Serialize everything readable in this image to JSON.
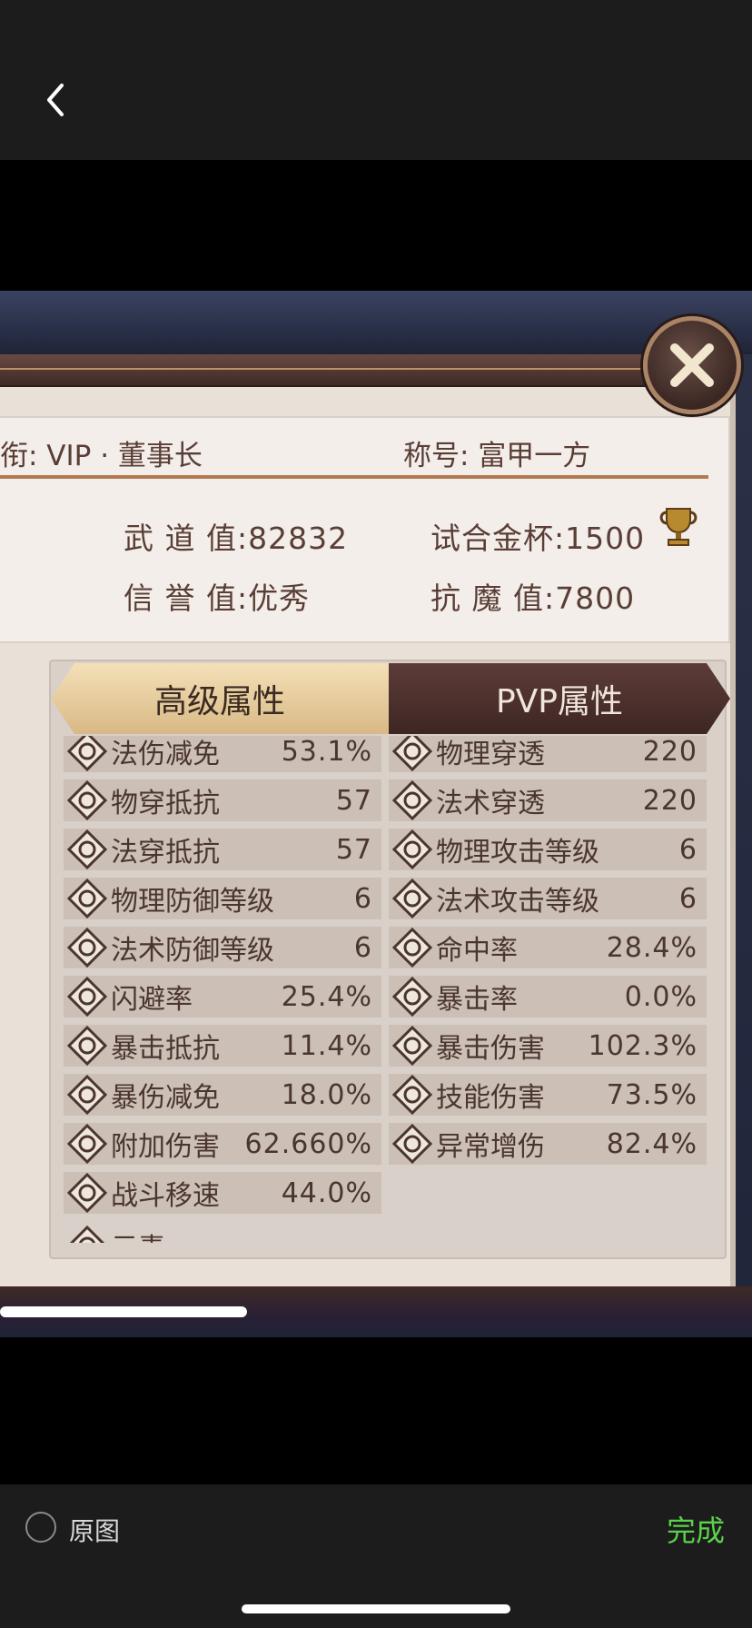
{
  "viewer": {
    "original_label": "原图",
    "done_label": "完成"
  },
  "profile": {
    "rank_text": "衔: VIP · 董事长",
    "title_text": "称号: 富甲一方",
    "wudao_text": "武 道 值:82832",
    "trophy_text": "试合金杯:1500",
    "xinyu_text": "信 誉 值:优秀",
    "kangmo_text": "抗 魔 值:7800"
  },
  "tabs": {
    "advanced": "高级属性",
    "pvp": "PVP属性"
  },
  "attributes_left": [
    {
      "label": "法伤减免",
      "value": "53.1%"
    },
    {
      "label": "物穿抵抗",
      "value": "57"
    },
    {
      "label": "法穿抵抗",
      "value": "57"
    },
    {
      "label": "物理防御等级",
      "value": "6"
    },
    {
      "label": "法术防御等级",
      "value": "6"
    },
    {
      "label": "闪避率",
      "value": "25.4%"
    },
    {
      "label": "暴击抵抗",
      "value": "11.4%"
    },
    {
      "label": "暴伤减免",
      "value": "18.0%"
    },
    {
      "label": "附加伤害",
      "value": "62.660%"
    },
    {
      "label": "战斗移速",
      "value": "44.0%"
    }
  ],
  "attributes_right": [
    {
      "label": "物理穿透",
      "value": "220"
    },
    {
      "label": "法术穿透",
      "value": "220"
    },
    {
      "label": "物理攻击等级",
      "value": "6"
    },
    {
      "label": "法术攻击等级",
      "value": "6"
    },
    {
      "label": "命中率",
      "value": "28.4%"
    },
    {
      "label": "暴击率",
      "value": "0.0%"
    },
    {
      "label": "暴击伤害",
      "value": "102.3%"
    },
    {
      "label": "技能伤害",
      "value": "73.5%"
    },
    {
      "label": "异常增伤",
      "value": "82.4%"
    }
  ],
  "section_partial": "元素",
  "colors": {
    "accent_green": "#5bd04a",
    "text_brown": "#5a3e36",
    "tab_gold": "#e3c795",
    "tab_dark": "#4d312d"
  }
}
